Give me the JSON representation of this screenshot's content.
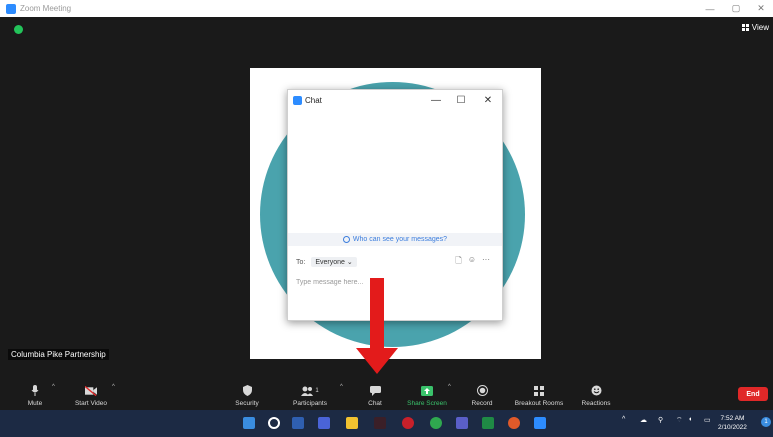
{
  "window": {
    "title": "Zoom Meeting",
    "minimize": "—",
    "maximize": "▢",
    "close": "✕"
  },
  "meeting": {
    "view_label": "View",
    "participant_name": "Columbia Pike Partnership",
    "avatar_color": "#4aa3ad"
  },
  "chat": {
    "title": "Chat",
    "minimize": "—",
    "maximize": "☐",
    "close": "✕",
    "visibility_link": "Who can see your messages?",
    "to_label": "To:",
    "recipient": "Everyone ⌄",
    "file_icon": "🗋",
    "emoji_icon": "☺",
    "more_icon": "···",
    "input_placeholder": "Type message here..."
  },
  "toolbar": {
    "mute": "Mute",
    "start_video": "Start Video",
    "security": "Security",
    "participants": "Participants",
    "participants_count": "1",
    "chat": "Chat",
    "share_screen": "Share Screen",
    "record": "Record",
    "breakout_rooms": "Breakout Rooms",
    "reactions": "Reactions",
    "end": "End",
    "caret": "^"
  },
  "taskbar": {
    "time": "7:52 AM",
    "date": "2/10/2022",
    "notifications": "1",
    "tray_chevron": "^"
  },
  "colors": {
    "accent": "#2d8cff",
    "end_red": "#e02828",
    "share_green": "#3ac26b",
    "arrow_red": "#e31b1b"
  }
}
